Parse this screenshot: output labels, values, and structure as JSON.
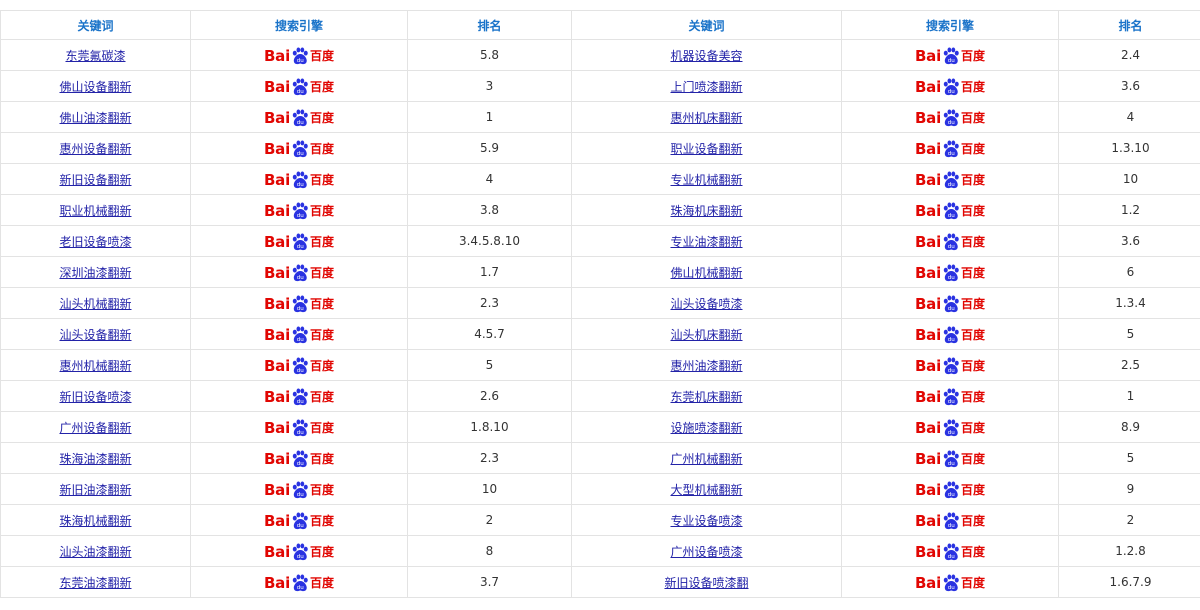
{
  "headers": [
    "关键词",
    "搜索引擎",
    "排名",
    "关键词",
    "搜索引擎",
    "排名"
  ],
  "engine_logo": {
    "latin": "Bai",
    "paw_text": "du",
    "chinese": "百度",
    "color": "#e10602",
    "paw_color": "#2932e1"
  },
  "colors": {
    "header_text": "#1a73c9",
    "link": "#2323a8",
    "border": "#e3e3e3"
  },
  "rows": [
    {
      "left": {
        "keyword": "东莞氟碳漆",
        "rank": "5.8"
      },
      "right": {
        "keyword": "机器设备美容",
        "rank": "2.4"
      }
    },
    {
      "left": {
        "keyword": "佛山设备翻新",
        "rank": "3"
      },
      "right": {
        "keyword": "上门喷漆翻新",
        "rank": "3.6"
      }
    },
    {
      "left": {
        "keyword": "佛山油漆翻新",
        "rank": "1"
      },
      "right": {
        "keyword": "惠州机床翻新",
        "rank": "4"
      }
    },
    {
      "left": {
        "keyword": "惠州设备翻新",
        "rank": "5.9"
      },
      "right": {
        "keyword": "职业设备翻新",
        "rank": "1.3.10"
      }
    },
    {
      "left": {
        "keyword": "新旧设备翻新",
        "rank": "4"
      },
      "right": {
        "keyword": "专业机械翻新",
        "rank": "10"
      }
    },
    {
      "left": {
        "keyword": "职业机械翻新",
        "rank": "3.8"
      },
      "right": {
        "keyword": "珠海机床翻新",
        "rank": "1.2"
      }
    },
    {
      "left": {
        "keyword": "老旧设备喷漆",
        "rank": "3.4.5.8.10"
      },
      "right": {
        "keyword": "专业油漆翻新",
        "rank": "3.6"
      }
    },
    {
      "left": {
        "keyword": "深圳油漆翻新",
        "rank": "1.7"
      },
      "right": {
        "keyword": "佛山机械翻新",
        "rank": "6"
      }
    },
    {
      "left": {
        "keyword": "汕头机械翻新",
        "rank": "2.3"
      },
      "right": {
        "keyword": "汕头设备喷漆",
        "rank": "1.3.4"
      }
    },
    {
      "left": {
        "keyword": "汕头设备翻新",
        "rank": "4.5.7"
      },
      "right": {
        "keyword": "汕头机床翻新",
        "rank": "5"
      }
    },
    {
      "left": {
        "keyword": "惠州机械翻新",
        "rank": "5"
      },
      "right": {
        "keyword": "惠州油漆翻新",
        "rank": "2.5"
      }
    },
    {
      "left": {
        "keyword": "新旧设备喷漆",
        "rank": "2.6"
      },
      "right": {
        "keyword": "东莞机床翻新",
        "rank": "1"
      }
    },
    {
      "left": {
        "keyword": "广州设备翻新",
        "rank": "1.8.10"
      },
      "right": {
        "keyword": "设施喷漆翻新",
        "rank": "8.9"
      }
    },
    {
      "left": {
        "keyword": "珠海油漆翻新",
        "rank": "2.3"
      },
      "right": {
        "keyword": "广州机械翻新",
        "rank": "5"
      }
    },
    {
      "left": {
        "keyword": "新旧油漆翻新",
        "rank": "10"
      },
      "right": {
        "keyword": "大型机械翻新",
        "rank": "9"
      }
    },
    {
      "left": {
        "keyword": "珠海机械翻新",
        "rank": "2"
      },
      "right": {
        "keyword": "专业设备喷漆",
        "rank": "2"
      }
    },
    {
      "left": {
        "keyword": "汕头油漆翻新",
        "rank": "8"
      },
      "right": {
        "keyword": "广州设备喷漆",
        "rank": "1.2.8"
      }
    },
    {
      "left": {
        "keyword": "东莞油漆翻新",
        "rank": "3.7"
      },
      "right": {
        "keyword": "新旧设备喷漆翻",
        "rank": "1.6.7.9"
      }
    }
  ]
}
